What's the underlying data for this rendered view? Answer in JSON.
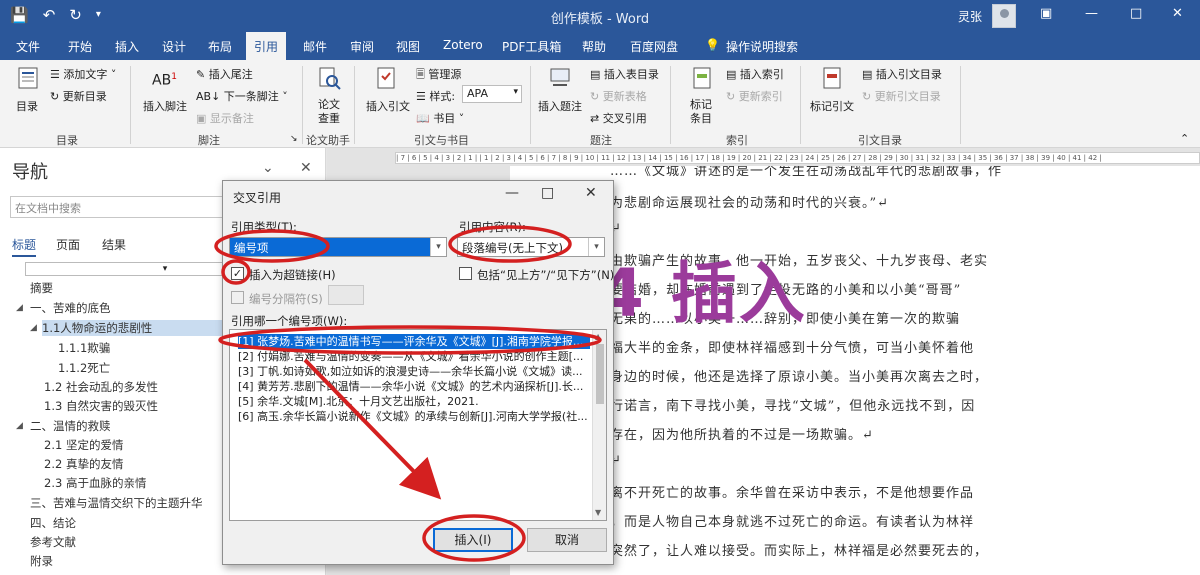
{
  "window": {
    "title": "创作模板 - Word",
    "user": "灵张",
    "qat_icons": [
      "save-icon",
      "undo-icon",
      "redo-icon",
      "customize-icon"
    ]
  },
  "menu_tabs": [
    "文件",
    "开始",
    "插入",
    "设计",
    "布局",
    "引用",
    "邮件",
    "审阅",
    "视图",
    "Zotero",
    "PDF工具箱",
    "帮助",
    "百度网盘",
    "操作说明搜索"
  ],
  "active_tab": "引用",
  "ribbon": {
    "toc": {
      "big": "目录",
      "add_text": "添加文字",
      "update": "更新目录",
      "group": "目录"
    },
    "footnotes": {
      "insert": "插入脚注",
      "insert_endnote": "插入尾注",
      "next": "下一条脚注",
      "show": "显示备注",
      "group": "脚注",
      "ab_label": "AB"
    },
    "research": {
      "big1": "论文",
      "big2": "查重",
      "group": "论文助手"
    },
    "citations": {
      "insert": "插入引文",
      "manage": "管理源",
      "style_label": "样式:",
      "style_value": "APA",
      "biblio": "书目",
      "group": "引文与书目"
    },
    "captions": {
      "insert": "插入题注",
      "insert_table": "插入表目录",
      "update_table": "更新表格",
      "cross_ref": "交叉引用",
      "group": "题注"
    },
    "index": {
      "mark1": "标记",
      "mark2": "条目",
      "insert": "插入索引",
      "update": "更新索引",
      "group": "索引"
    },
    "toa": {
      "mark": "标记引文",
      "insert": "插入引文目录",
      "update": "更新引文目录",
      "group": "引文目录"
    }
  },
  "nav": {
    "title": "导航",
    "search_placeholder": "在文档中搜索",
    "tabs": [
      "标题",
      "页面",
      "结果"
    ],
    "headings": [
      {
        "text": "摘要"
      },
      {
        "text": "一、苦难的底色"
      },
      {
        "text": "1.1人物命运的悲剧性"
      },
      {
        "text": "1.1.1欺骗"
      },
      {
        "text": "1.1.2死亡"
      },
      {
        "text": "1.2 社会动乱的多发性"
      },
      {
        "text": "1.3 自然灾害的毁灭性"
      },
      {
        "text": "二、温情的救赎"
      },
      {
        "text": "2.1 坚定的爱情"
      },
      {
        "text": "2.2 真挚的友情"
      },
      {
        "text": "2.3 高于血脉的亲情"
      },
      {
        "text": "三、苦难与温情交织下的主题升华"
      },
      {
        "text": "四、结论"
      },
      {
        "text": "参考文献"
      },
      {
        "text": "附录"
      }
    ]
  },
  "ruler_text": "| 7 | 6 | 5 | 4 | 3 | 2 | 1 |   | 1 | 2 | 3 | 4 | 5 | 6 | 7 | 8 | 9 | 10 | 11 | 12 | 13 | 14 | 15 | 16 | 17 | 18 | 19 | 20 | 21 | 22 | 23 | 24 | 25 | 26 | 27 | 28 | 29 | 30 | 31 | 32 | 33 | 34 | 35 | 36 | 37 | 38 | 39 | 40 | 41 | 42 |",
  "document_lines": [
    "……《文城》讲述的是一个发生在动荡战乱年代的悲剧故事，作",
    "为悲剧命运展现社会的动荡和时代的兴衰。”↵",
    "↵",
    "由欺骗产生的故事。他一开始，五岁丧父、十九岁丧母、老实",
    "要结婚，却在婚前遇到了走投无路的小美和以小美“哥哥”",
    "无果的……以小美一……辞别，即使小美在第一次的欺骗",
    "福大半的金条，即使林祥福感到十分气愤，可当小美怀着他",
    "身边的时候，他还是选择了原谅小美。当小美再次离去之时，",
    "行诺言，南下寻找小美，寻找“文城”，但他永远找不到，因",
    "存在，因为他所执着的不过是一场欺骗。↵",
    "↵",
    "离不开死亡的故事。余华曾在采访中表示，不是他想要作品",
    "，而是人物自己本身就逃不过死亡的命运。有读者认为林祥",
    "突然了，让人难以接受。而实际上，林祥福是必然要死去的，"
  ],
  "annotation": {
    "text": "4 插入"
  },
  "dialog": {
    "title": "交叉引用",
    "ref_type_label": "引用类型(T):",
    "ref_type_value": "编号项",
    "ref_content_label": "引用内容(R):",
    "ref_content_value": "段落编号(无上下文)",
    "hyperlink_label": "插入为超链接(H)",
    "hyperlink_checked": true,
    "above_below_label": "包括“见上方”/“见下方”(N)",
    "above_below_checked": false,
    "separator_label": "编号分隔符(S)",
    "which_label": "引用哪一个编号项(W):",
    "items": [
      "[1] 张梦炀.苦难中的温情书写——评余华及《文城》[J].湘南学院学报...",
      "[2] 付娟娜.苦难与温情的变奏——从《文城》看余华小说的创作主题[...",
      "[3] 丁帆.如诗如歌,如泣如诉的浪漫史诗——余华长篇小说《文城》读...",
      "[4] 黄芳芳.悲剧下的温情——余华小说《文城》的艺术内涵探析[J].长...",
      "[5] 余华.文城[M].北京：十月文艺出版社，2021.",
      "[6] 高玉.余华长篇小说新作《文城》的承续与创新[J].河南大学学报(社..."
    ],
    "selected_index": 0,
    "insert_btn": "插入(I)",
    "cancel_btn": "取消"
  },
  "colors": {
    "word_blue": "#2b579a",
    "annotation_red": "#d42020",
    "annotation_purple": "#9b3b9b",
    "selection_blue": "#0a6ad6"
  }
}
